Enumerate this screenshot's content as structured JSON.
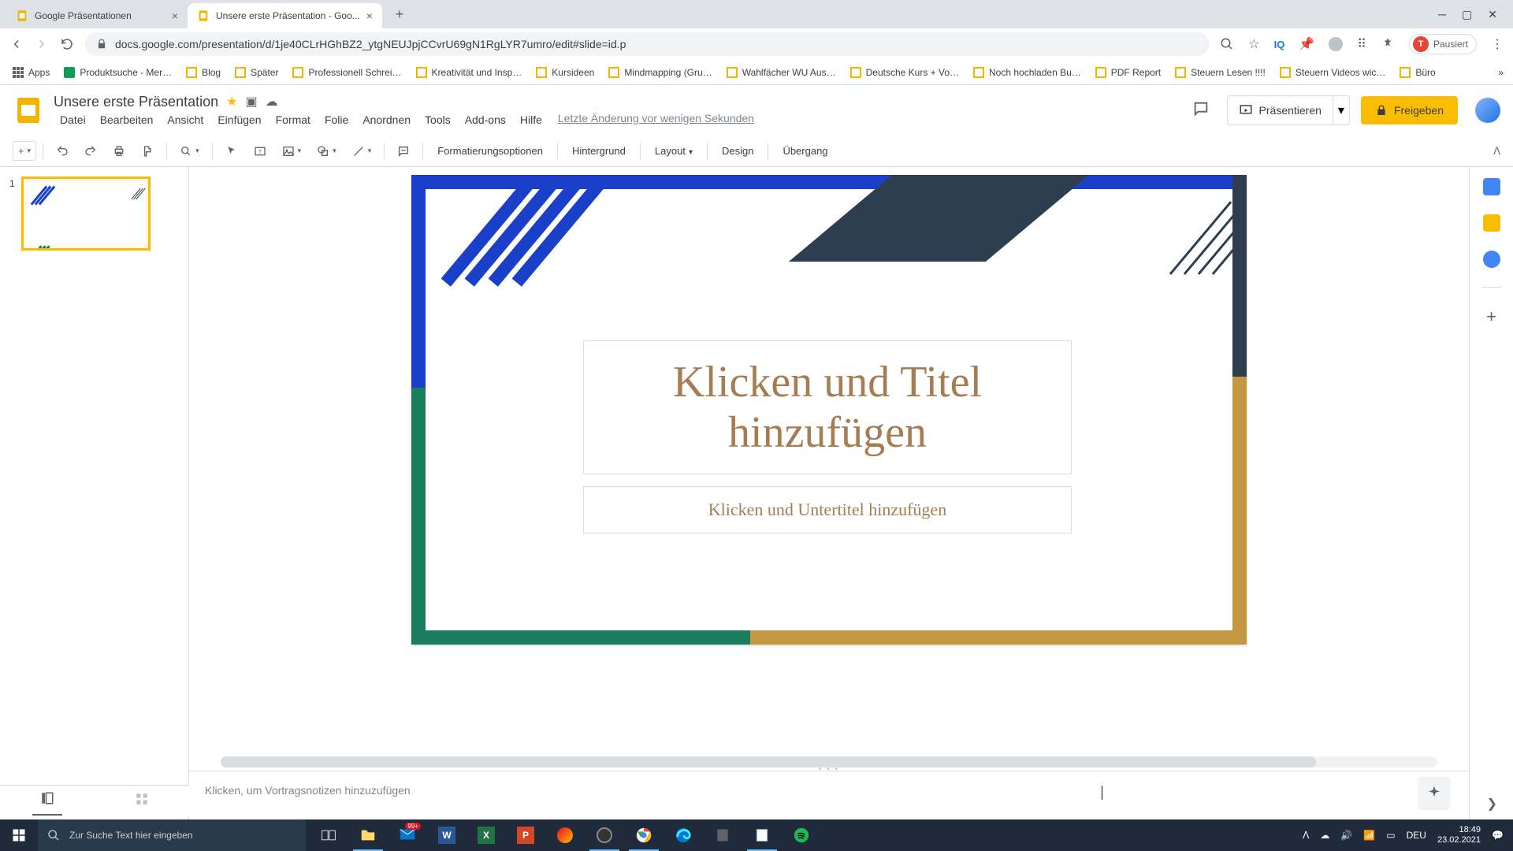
{
  "browser": {
    "tabs": [
      {
        "title": "Google Präsentationen",
        "active": false
      },
      {
        "title": "Unsere erste Präsentation - Goo...",
        "active": true
      }
    ],
    "url": "docs.google.com/presentation/d/1je40CLrHGhBZ2_ytgNEUJpjCCvrU69gN1RgLYR7umro/edit#slide=id.p",
    "profile_label": "Pausiert",
    "profile_initial": "T",
    "bookmarks": {
      "apps": "Apps",
      "items": [
        "Produktsuche - Mer…",
        "Blog",
        "Später",
        "Professionell Schrei…",
        "Kreativität und Insp…",
        "Kursideen",
        "Mindmapping (Gru…",
        "Wahlfächer WU Aus…",
        "Deutsche Kurs + Vo…",
        "Noch hochladen Bu…",
        "PDF Report",
        "Steuern Lesen !!!!",
        "Steuern Videos wic…",
        "Büro"
      ]
    }
  },
  "slides": {
    "doc_title": "Unsere erste Präsentation",
    "menus": [
      "Datei",
      "Bearbeiten",
      "Ansicht",
      "Einfügen",
      "Format",
      "Folie",
      "Anordnen",
      "Tools",
      "Add-ons",
      "Hilfe"
    ],
    "last_edit": "Letzte Änderung vor wenigen Sekunden",
    "present": "Präsentieren",
    "share": "Freigeben",
    "toolbar": {
      "format_options": "Formatierungsoptionen",
      "background": "Hintergrund",
      "layout": "Layout",
      "design": "Design",
      "transition": "Übergang"
    },
    "slide_number": "1",
    "canvas": {
      "title_placeholder": "Klicken und Titel hinzufügen",
      "subtitle_placeholder": "Klicken und Untertitel hinzufügen"
    },
    "notes_placeholder": "Klicken, um Vortragsnotizen hinzuzufügen"
  },
  "taskbar": {
    "search_placeholder": "Zur Suche Text hier eingeben",
    "lang": "DEU",
    "time": "18:49",
    "date": "23.02.2021",
    "notif": "99+"
  }
}
